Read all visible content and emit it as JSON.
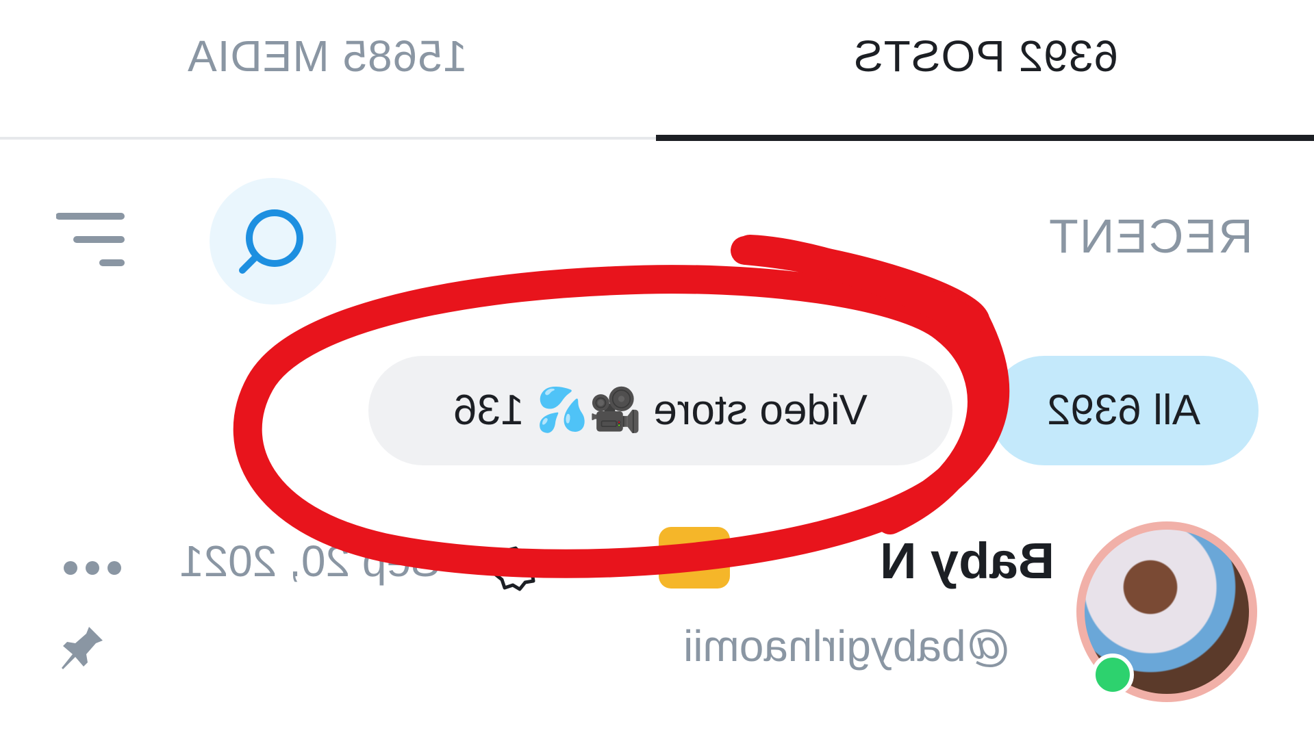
{
  "tabs": [
    {
      "label": "6392 POSTS"
    },
    {
      "label": "15685 MEDIA"
    }
  ],
  "toolbar": {
    "sort_label": "RECENT",
    "search_icon": "search-icon",
    "filter_icon": "filter-lines-icon"
  },
  "chips": [
    {
      "label": "All 6392"
    },
    {
      "label": "Video store 🎥💦 136"
    }
  ],
  "post": {
    "display_name": "Baby N",
    "handle": "@babygirlnaomii",
    "date": "Sep 20, 2021",
    "more_icon": "more-dots-icon",
    "pin_icon": "pin-icon"
  },
  "colors": {
    "accent_chip": "#c4e9fb",
    "search_bg": "#eaf6fd",
    "annotation": "#e8141c",
    "online": "#2dd26e"
  }
}
